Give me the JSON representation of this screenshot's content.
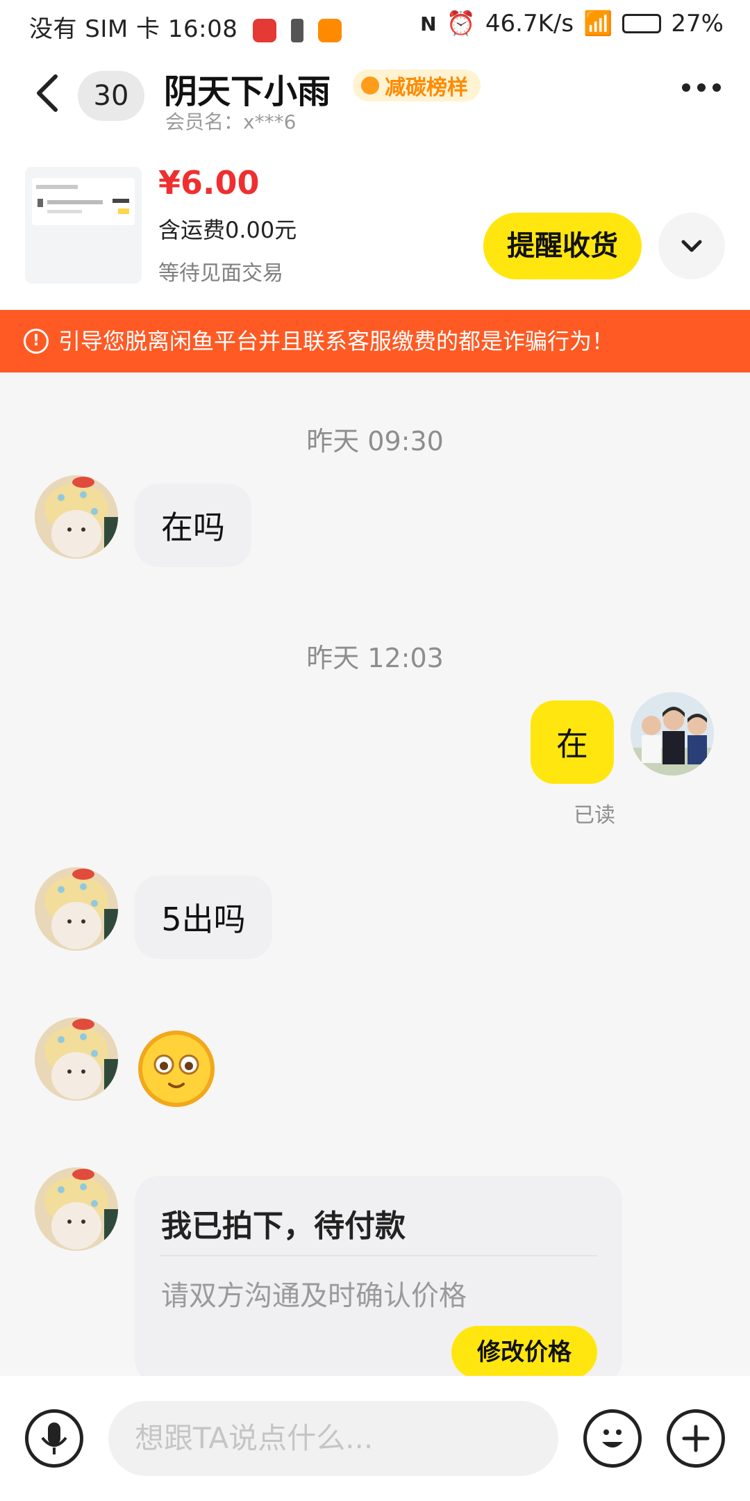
{
  "status_bar": {
    "left": "没有 SIM 卡 16:08",
    "net_speed": "46.7K/s",
    "battery": "27%"
  },
  "header": {
    "unread_count": "30",
    "title": "阴天下小雨",
    "tag": "减碳榜样",
    "member": "会员名：x***6"
  },
  "order": {
    "price": "¥6.00",
    "shipping": "含运费0.00元",
    "status": "等待见面交易",
    "remind_button": "提醒收货"
  },
  "banner": {
    "text": "引导您脱离闲鱼平台并且联系客服缴费的都是诈骗行为！"
  },
  "chat": {
    "time1": "昨天 09:30",
    "msg1": "在吗",
    "time2": "昨天 12:03",
    "msg2_me": "在",
    "read_label": "已读",
    "msg3": "5出吗",
    "card_title": "我已拍下，待付款",
    "card_desc": "请双方沟通及时确认价格",
    "card_button": "修改价格"
  },
  "input": {
    "placeholder": "想跟TA说点什么..."
  },
  "colors": {
    "accent_yellow": "#ffe60f",
    "banner_orange": "#ff5a24",
    "price_red": "#ef2f2f"
  }
}
